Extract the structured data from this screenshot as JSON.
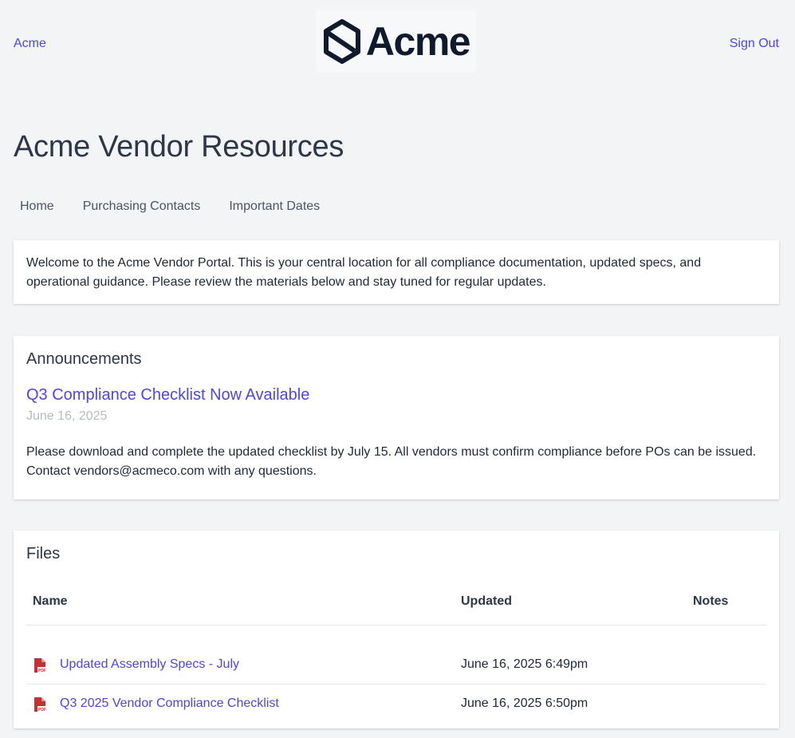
{
  "header": {
    "brand_link": "Acme",
    "logo_text": "Acme",
    "sign_out": "Sign Out"
  },
  "page": {
    "title": "Acme Vendor Resources"
  },
  "nav": {
    "items": [
      {
        "label": "Home"
      },
      {
        "label": "Purchasing Contacts"
      },
      {
        "label": "Important Dates"
      }
    ]
  },
  "welcome": {
    "text": "Welcome to the Acme Vendor Portal. This is your central location for all compliance documentation, updated specs, and operational guidance. Please review the materials below and stay tuned for regular updates."
  },
  "announcements": {
    "heading": "Announcements",
    "items": [
      {
        "title": "Q3 Compliance Checklist Now Available",
        "date": "June 16, 2025",
        "body": "Please download and complete the updated checklist by July 15. All vendors must confirm compliance before POs can be issued. Contact vendors@acmeco.com with any questions."
      }
    ]
  },
  "files": {
    "heading": "Files",
    "columns": {
      "name": "Name",
      "updated": "Updated",
      "notes": "Notes"
    },
    "rows": [
      {
        "icon": "pdf-file-icon",
        "name": "Updated Assembly Specs - July",
        "updated": "June 16, 2025 6:49pm",
        "notes": ""
      },
      {
        "icon": "pdf-file-icon",
        "name": "Q3 2025 Vendor Compliance Checklist",
        "updated": "June 16, 2025 6:50pm",
        "notes": ""
      }
    ]
  },
  "colors": {
    "accent": "#4f46e5",
    "background": "#f3f4f6",
    "pdf_red": "#c53030"
  }
}
